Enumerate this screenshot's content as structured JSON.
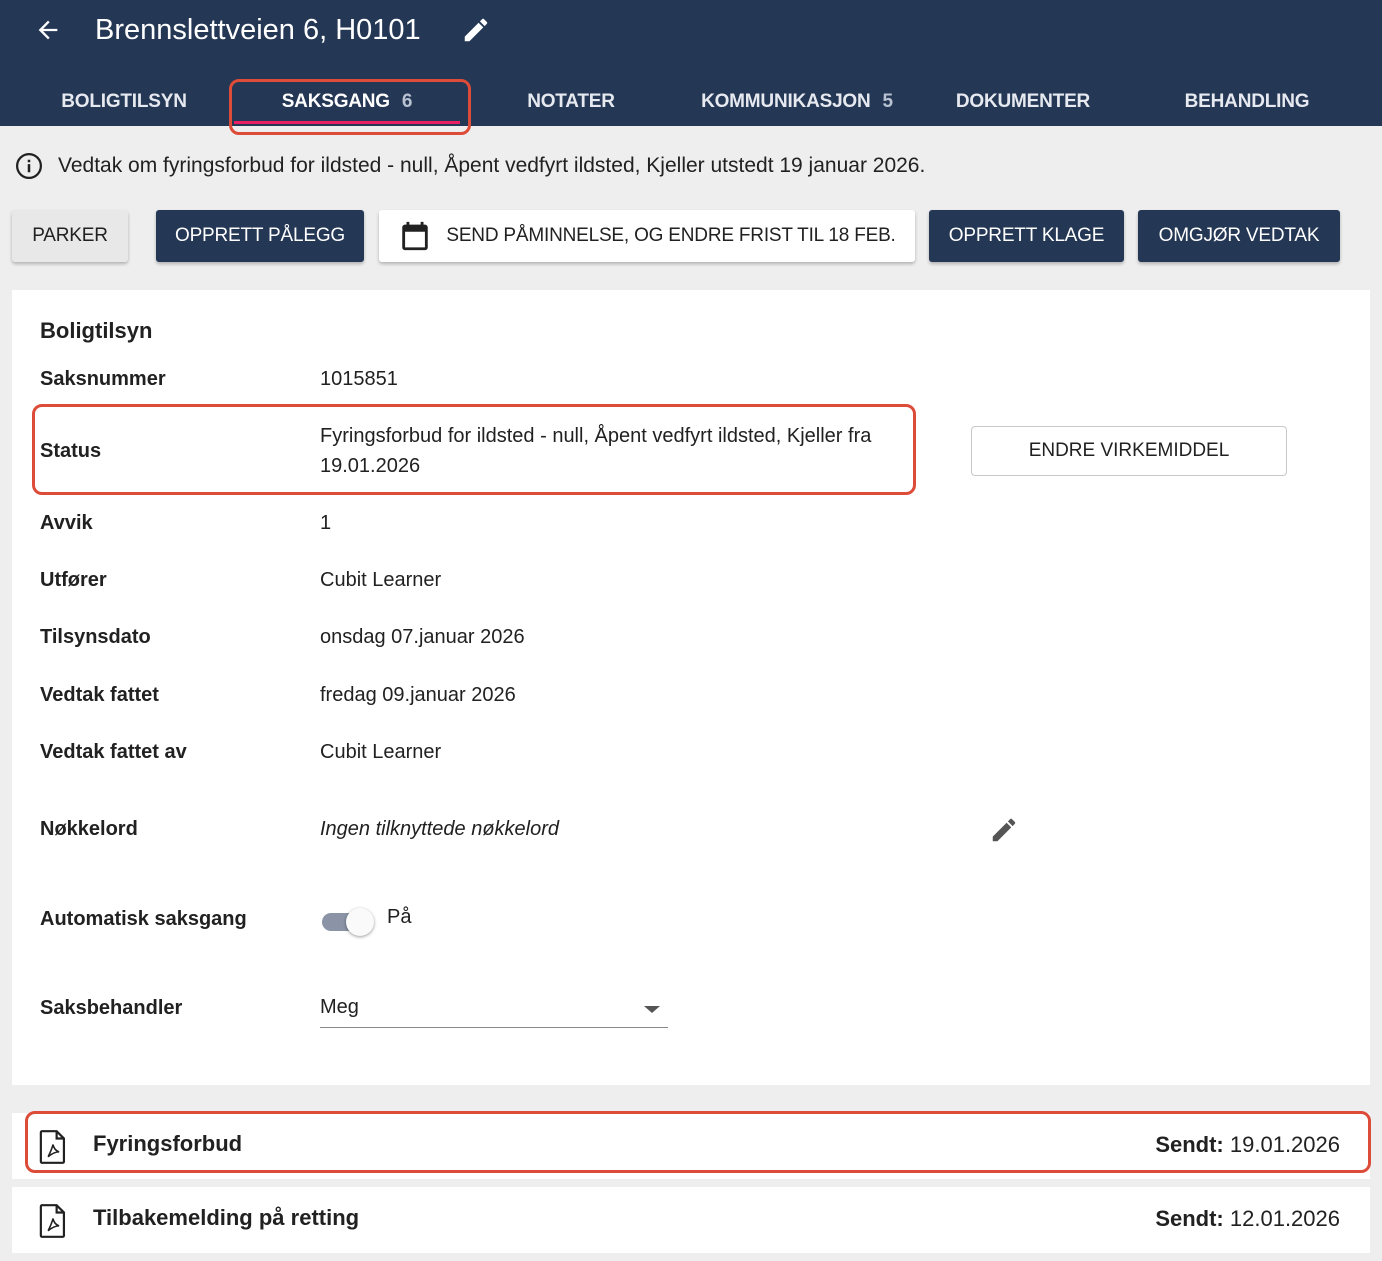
{
  "header": {
    "title": "Brennslettveien 6, H0101",
    "back_icon": "arrow-left-icon",
    "edit_icon": "pencil-icon"
  },
  "tabs": [
    {
      "label": "BOLIGTILSYN",
      "count": ""
    },
    {
      "label": "SAKSGANG",
      "count": "6",
      "active": true
    },
    {
      "label": "NOTATER",
      "count": ""
    },
    {
      "label": "KOMMUNIKASJON",
      "count": "5"
    },
    {
      "label": "DOKUMENTER",
      "count": ""
    },
    {
      "label": "BEHANDLING",
      "count": ""
    }
  ],
  "info": {
    "text": "Vedtak om fyringsforbud for ildsted - null, Åpent vedfyrt ildsted, Kjeller utstedt 19 januar 2026."
  },
  "actions": {
    "parker": "PARKER",
    "opprett_palegg": "OPPRETT PÅLEGG",
    "send_paminnelse": "SEND PÅMINNELSE, OG ENDRE FRIST TIL 18 FEB.",
    "opprett_klage": "OPPRETT KLAGE",
    "omgjor_vedtak": "OMGJØR VEDTAK"
  },
  "details": {
    "title": "Boligtilsyn",
    "saksnummer_label": "Saksnummer",
    "saksnummer": "1015851",
    "status_label": "Status",
    "status": "Fyringsforbud for ildsted - null, Åpent vedfyrt ildsted, Kjeller fra 19.01.2026",
    "endre_virkemiddel": "ENDRE VIRKEMIDDEL",
    "avvik_label": "Avvik",
    "avvik": "1",
    "utforer_label": "Utfører",
    "utforer": "Cubit Learner",
    "tilsynsdato_label": "Tilsynsdato",
    "tilsynsdato": "onsdag 07.januar 2026",
    "vedtak_fattet_label": "Vedtak fattet",
    "vedtak_fattet": "fredag 09.januar 2026",
    "vedtak_fattet_av_label": "Vedtak fattet av",
    "vedtak_fattet_av": "Cubit Learner",
    "nokkelord_label": "Nøkkelord",
    "nokkelord": "Ingen tilknyttede nøkkelord",
    "automatisk_label": "Automatisk saksgang",
    "automatisk_value": "På",
    "automatisk_on": true,
    "saksbehandler_label": "Saksbehandler",
    "saksbehandler": "Meg"
  },
  "documents": [
    {
      "name": "Fyringsforbud",
      "sent_label": "Sendt:",
      "sent_date": "19.01.2026"
    },
    {
      "name": "Tilbakemelding på retting",
      "sent_label": "Sendt:",
      "sent_date": "12.01.2026"
    }
  ],
  "colors": {
    "header_bg": "#243755",
    "tab_indicator": "#e91e63",
    "highlight": "#dd4b39"
  }
}
